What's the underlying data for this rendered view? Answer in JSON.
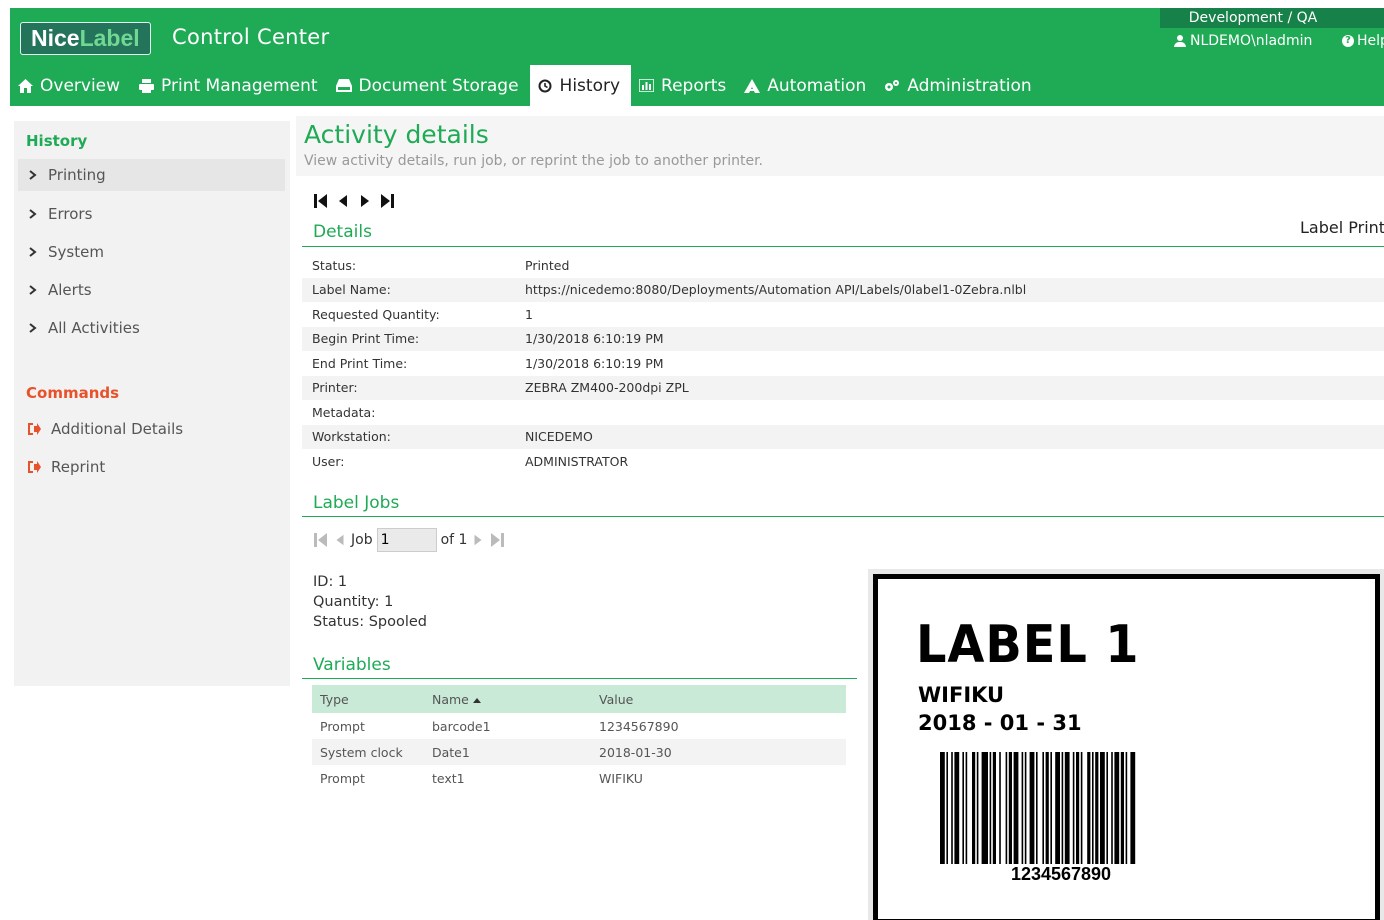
{
  "brand": {
    "logo_part1": "Nice",
    "logo_part2": "Label",
    "app_title": "Control Center"
  },
  "header": {
    "environment": "Development / QA",
    "user": "NLDEMO\\nladmin",
    "help": "Help"
  },
  "nav": [
    {
      "label": "Overview",
      "icon": "home-icon"
    },
    {
      "label": "Print Management",
      "icon": "printer-icon"
    },
    {
      "label": "Document Storage",
      "icon": "storage-icon"
    },
    {
      "label": "History",
      "icon": "history-icon",
      "active": true
    },
    {
      "label": "Reports",
      "icon": "chart-icon"
    },
    {
      "label": "Automation",
      "icon": "automation-icon"
    },
    {
      "label": "Administration",
      "icon": "gears-icon"
    }
  ],
  "sidebar": {
    "history_heading": "History",
    "history_items": [
      "Printing",
      "Errors",
      "System",
      "Alerts",
      "All Activities"
    ],
    "commands_heading": "Commands",
    "command_items": [
      "Additional Details",
      "Reprint"
    ]
  },
  "page": {
    "title": "Activity details",
    "subtitle": "View activity details, run job, or reprint the job to another printer."
  },
  "details": {
    "section_title": "Details",
    "activity_type": "Label Print",
    "rows": [
      {
        "key": "Status:",
        "value": "Printed"
      },
      {
        "key": "Label Name:",
        "value": "https://nicedemo:8080/Deployments/Automation API/Labels/0label1-0Zebra.nlbl"
      },
      {
        "key": "Requested Quantity:",
        "value": "1"
      },
      {
        "key": "Begin Print Time:",
        "value": "1/30/2018 6:10:19 PM"
      },
      {
        "key": "End Print Time:",
        "value": "1/30/2018 6:10:19 PM"
      },
      {
        "key": "Printer:",
        "value": "ZEBRA ZM400-200dpi ZPL"
      },
      {
        "key": "Metadata:",
        "value": ""
      },
      {
        "key": "Workstation:",
        "value": "NICEDEMO"
      },
      {
        "key": "User:",
        "value": "ADMINISTRATOR"
      }
    ]
  },
  "label_jobs": {
    "section_title": "Label Jobs",
    "job_label": "Job",
    "job_value": "1",
    "of_label": "of 1",
    "id_line": "ID: 1",
    "quantity_line": "Quantity: 1",
    "status_line": "Status: Spooled"
  },
  "variables": {
    "section_title": "Variables",
    "columns": [
      "Type",
      "Name",
      "Value"
    ],
    "rows": [
      [
        "Prompt",
        "barcode1",
        "1234567890"
      ],
      [
        "System clock",
        "Date1",
        "2018-01-30"
      ],
      [
        "Prompt",
        "text1",
        "WIFIKU"
      ]
    ]
  },
  "label_preview": {
    "title": "LABEL 1",
    "text": "WIFIKU",
    "date": "2018 - 01 - 31",
    "barcode_text": "1234567890"
  },
  "colors": {
    "brand_green": "#1faa55",
    "commands_orange": "#e8522a",
    "env_green": "#17814a"
  }
}
